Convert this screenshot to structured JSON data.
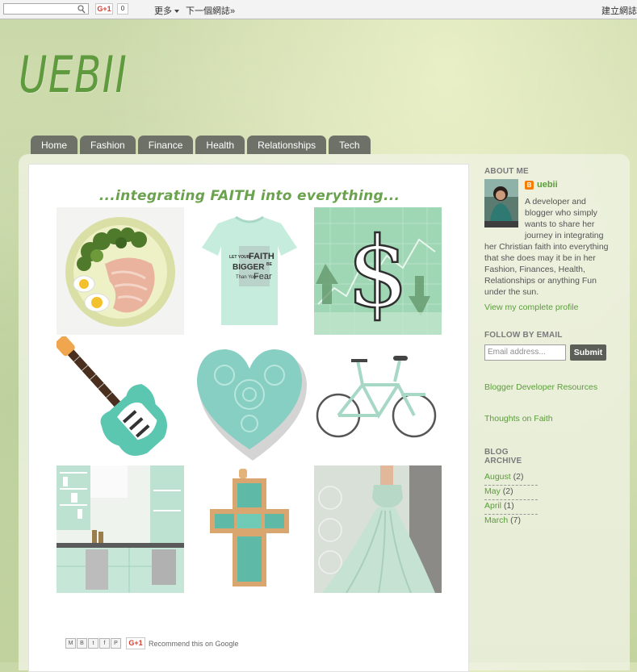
{
  "navbar": {
    "search_placeholder": "",
    "gplus_label": "G+1",
    "gplus_count": "0",
    "more_label": "更多",
    "next_blog_label": "下一個網誌»",
    "create_blog_label": "建立網誌"
  },
  "header": {
    "blog_title": "UEBII"
  },
  "tabs": [
    "Home",
    "Fashion",
    "Finance",
    "Health",
    "Relationships",
    "Tech"
  ],
  "post": {
    "tagline": "...integrating FAITH into everything...",
    "tshirt_text": {
      "line1": "LET YOUR",
      "line2": "FAITH",
      "line3": "BIGGER",
      "line4": "BE",
      "line5": "Than Your",
      "line6": "Fear"
    },
    "share_buttons": [
      "M",
      "B",
      "t",
      "f",
      "P"
    ],
    "gplus_label": "G+1",
    "recommend_text": "Recommend this on Google"
  },
  "sidebar": {
    "about_heading": "ABOUT ME",
    "about_name": "uebii",
    "about_text": "A developer and blogger who simply wants to share her journey in integrating her Christian faith into everything that she does may it be in her Fashion, Finances, Health, Relationships or anything Fun under the sun.",
    "about_lines": [
      "A developer and",
      "blogger who simply",
      "wants to share her",
      "journey in integrating",
      "her Christian faith into everything",
      "that she does may it be in her",
      "Fashion, Finances, Health,",
      "Relationships or anything Fun",
      "under the sun."
    ],
    "view_profile": "View my complete profile",
    "follow_heading": "FOLLOW BY EMAIL",
    "email_placeholder": "Email address...",
    "submit_label": "Submit",
    "link1": "Blogger Developer Resources",
    "link2": "Thoughts on Faith",
    "archive_heading_line1": "BLOG",
    "archive_heading_line2": "ARCHIVE",
    "archive": [
      {
        "month": "August",
        "count": "(2)"
      },
      {
        "month": "May",
        "count": "(2)"
      },
      {
        "month": "April",
        "count": "(1)"
      },
      {
        "month": "March",
        "count": "(7)"
      }
    ]
  },
  "colors": {
    "accent_green": "#5a9d3a",
    "tab_bg": "#6d7168",
    "mint": "#8fd3bd"
  }
}
